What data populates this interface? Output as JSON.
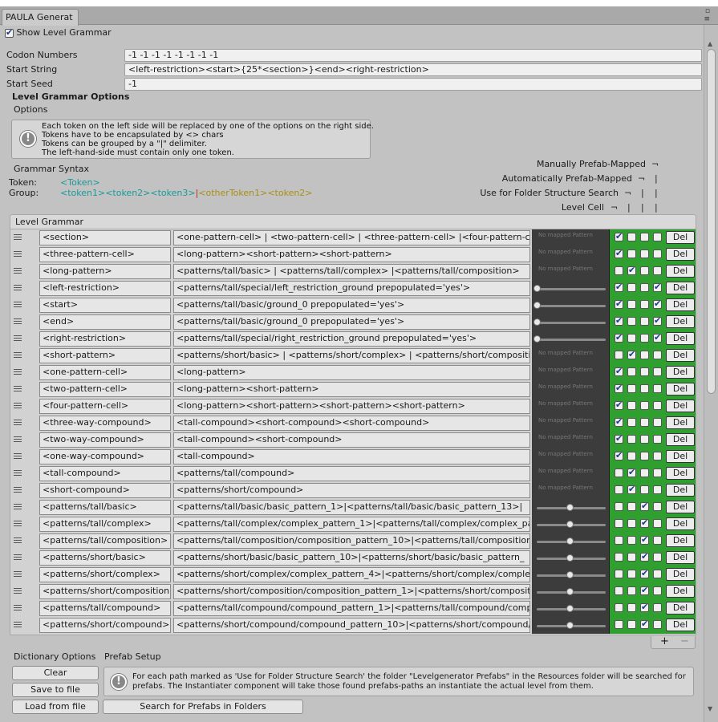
{
  "window": {
    "tab_title": "PAULA Generat",
    "controls": "▫ ≡"
  },
  "show_level_grammar": {
    "label": "Show Level Grammar",
    "checked": true
  },
  "fields": [
    {
      "label": "Codon Numbers",
      "value": "-1 -1 -1 -1 -1 -1 -1 -1"
    },
    {
      "label": "Start String",
      "value": "<left-restriction><start>{25*<section>}<end><right-restriction>"
    },
    {
      "label": "Start Seed",
      "value": "-1"
    }
  ],
  "options": {
    "heading": "Level Grammar Options",
    "subheading": "Options",
    "help_lines": [
      "Each token on the left side will be replaced by one of the options on the right side.",
      "Tokens have to be encapsulated by <> chars",
      "Tokens can be grouped by a \"|\" delimiter.",
      "The left-hand-side must contain only one token."
    ]
  },
  "syntax": {
    "heading": "Grammar Syntax",
    "token_label": "Token:",
    "token_example": "<Token>",
    "group_label": "Group:",
    "group_cyan": "<token1><token2><token3>",
    "group_bar": "|",
    "group_yellow": "<otherToken1><token2>"
  },
  "column_legend": [
    "Manually Prefab-Mapped",
    "Automatically Prefab-Mapped",
    "Use for Folder Structure Search",
    "Level Cell"
  ],
  "level_grammar": {
    "title": "Level Grammar",
    "no_mapped_text": "No mapped Pattern",
    "del_label": "Del",
    "rows": [
      {
        "token": "<section>",
        "rule": "<one-pattern-cell> | <two-pattern-cell> | <three-pattern-cell>  |<four-pattern-cell>",
        "mapped": false,
        "slider": null,
        "checks": [
          true,
          false,
          false,
          false
        ]
      },
      {
        "token": "<three-pattern-cell>",
        "rule": "<long-pattern><short-pattern><short-pattern>",
        "mapped": false,
        "slider": null,
        "checks": [
          true,
          false,
          false,
          false
        ]
      },
      {
        "token": "<long-pattern>",
        "rule": "<patterns/tall/basic> | <patterns/tall/complex> |<patterns/tall/composition>",
        "mapped": false,
        "slider": null,
        "checks": [
          false,
          true,
          false,
          false
        ]
      },
      {
        "token": "<left-restriction>",
        "rule": "<patterns/tall/special/left_restriction_ground prepopulated='yes'>",
        "mapped": true,
        "slider": 0.0,
        "checks": [
          true,
          false,
          false,
          true
        ]
      },
      {
        "token": "<start>",
        "rule": "<patterns/tall/basic/ground_0 prepopulated='yes'>",
        "mapped": true,
        "slider": 0.0,
        "checks": [
          true,
          false,
          false,
          true
        ]
      },
      {
        "token": "<end>",
        "rule": "<patterns/tall/basic/ground_0 prepopulated='yes'>",
        "mapped": true,
        "slider": 0.0,
        "checks": [
          true,
          false,
          false,
          true
        ]
      },
      {
        "token": "<right-restriction>",
        "rule": "<patterns/tall/special/right_restriction_ground prepopulated='yes'>",
        "mapped": true,
        "slider": 0.0,
        "checks": [
          true,
          false,
          false,
          true
        ]
      },
      {
        "token": "<short-pattern>",
        "rule": "<patterns/short/basic> | <patterns/short/complex> | <patterns/short/composition>",
        "mapped": false,
        "slider": null,
        "checks": [
          false,
          true,
          false,
          false
        ]
      },
      {
        "token": "<one-pattern-cell>",
        "rule": "<long-pattern>",
        "mapped": false,
        "slider": null,
        "checks": [
          true,
          false,
          false,
          false
        ]
      },
      {
        "token": "<two-pattern-cell>",
        "rule": "<long-pattern><short-pattern>",
        "mapped": false,
        "slider": null,
        "checks": [
          true,
          false,
          false,
          false
        ]
      },
      {
        "token": "<four-pattern-cell>",
        "rule": "<long-pattern><short-pattern><short-pattern><short-pattern>",
        "mapped": false,
        "slider": null,
        "checks": [
          true,
          false,
          false,
          false
        ]
      },
      {
        "token": "<three-way-compound>",
        "rule": "<tall-compound><short-compound><short-compound>",
        "mapped": false,
        "slider": null,
        "checks": [
          true,
          false,
          false,
          false
        ]
      },
      {
        "token": "<two-way-compound>",
        "rule": "<tall-compound><short-compound>",
        "mapped": false,
        "slider": null,
        "checks": [
          true,
          false,
          false,
          false
        ]
      },
      {
        "token": "<one-way-compound>",
        "rule": "<tall-compound>",
        "mapped": false,
        "slider": null,
        "checks": [
          true,
          false,
          false,
          false
        ]
      },
      {
        "token": "<tall-compound>",
        "rule": "<patterns/tall/compound>",
        "mapped": false,
        "slider": null,
        "checks": [
          false,
          true,
          false,
          false
        ]
      },
      {
        "token": "<short-compound>",
        "rule": "<patterns/short/compound>",
        "mapped": false,
        "slider": null,
        "checks": [
          false,
          true,
          false,
          false
        ]
      },
      {
        "token": "<patterns/tall/basic>",
        "rule": "<patterns/tall/basic/basic_pattern_1>|<patterns/tall/basic/basic_pattern_13>|",
        "mapped": true,
        "slider": 0.5,
        "checks": [
          false,
          false,
          true,
          false
        ]
      },
      {
        "token": "<patterns/tall/complex>",
        "rule": "<patterns/tall/complex/complex_pattern_1>|<patterns/tall/complex/complex_pattern_",
        "mapped": true,
        "slider": 0.5,
        "checks": [
          false,
          false,
          true,
          false
        ]
      },
      {
        "token": "<patterns/tall/composition>",
        "rule": "<patterns/tall/composition/composition_pattern_10>|<patterns/tall/composition/",
        "mapped": true,
        "slider": 0.5,
        "checks": [
          false,
          false,
          true,
          false
        ]
      },
      {
        "token": "<patterns/short/basic>",
        "rule": "<patterns/short/basic/basic_pattern_10>|<patterns/short/basic/basic_pattern_",
        "mapped": true,
        "slider": 0.5,
        "checks": [
          false,
          false,
          true,
          false
        ]
      },
      {
        "token": "<patterns/short/complex>",
        "rule": "<patterns/short/complex/complex_pattern_4>|<patterns/short/complex/complex_",
        "mapped": true,
        "slider": 0.5,
        "checks": [
          false,
          false,
          true,
          false
        ]
      },
      {
        "token": "<patterns/short/composition>",
        "rule": "<patterns/short/composition/composition_pattern_1>|<patterns/short/composition/",
        "mapped": true,
        "slider": 0.5,
        "checks": [
          false,
          false,
          true,
          false
        ]
      },
      {
        "token": "<patterns/tall/compound>",
        "rule": "<patterns/tall/compound/compound_pattern_1>|<patterns/tall/compound/compound_",
        "mapped": true,
        "slider": 0.5,
        "checks": [
          false,
          false,
          true,
          false
        ]
      },
      {
        "token": "<patterns/short/compound>",
        "rule": "<patterns/short/compound/compound_pattern_10>|<patterns/short/compound/compound_",
        "mapped": true,
        "slider": 0.5,
        "checks": [
          false,
          false,
          true,
          false
        ]
      }
    ],
    "add_label": "+",
    "remove_label": "−"
  },
  "footer": {
    "dictionary_options": "Dictionary Options",
    "prefab_setup": "Prefab Setup",
    "clear": "Clear",
    "save": "Save to file",
    "load": "Load from file",
    "search": "Search for Prefabs in Folders",
    "prefab_help": "For each path marked as 'Use for Folder Structure Search' the folder \"Levelgenerator Prefabs\" in the Resources folder will be searched for prefabs. The Instantiater component will take those found prefabs-paths an instantiate the actual level from them."
  }
}
